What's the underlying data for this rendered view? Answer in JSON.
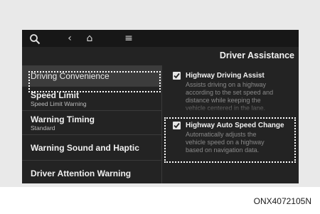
{
  "topbar": {
    "back_icon": "‹",
    "home_icon": "⌂",
    "menu_icon": "≡"
  },
  "header": {
    "title": "Driver Assistance"
  },
  "menu": {
    "items": [
      {
        "label": "Driving Convenience",
        "sub": ""
      },
      {
        "label": "Speed Limit",
        "sub": "Speed Limit Warning"
      },
      {
        "label": "Warning Timing",
        "sub": "Standard"
      },
      {
        "label": "Warning Sound and Haptic",
        "sub": ""
      },
      {
        "label": "Driver Attention Warning",
        "sub": ""
      }
    ]
  },
  "options": [
    {
      "title": "Highway Driving Assist",
      "checked": true,
      "description": "Assists driving on a highway\naccording to the set speed and\ndistance while keeping the\nvehicle centered in the lane."
    },
    {
      "title": "Highway Auto Speed Change",
      "checked": true,
      "description": "Automatically adjusts the\nvehicle speed on a highway\nbased on navigation data."
    }
  ],
  "caption": "ONX4072105N",
  "colors": {
    "screen_bg": "#232323",
    "topbar_bg": "#171717",
    "selected_bg": "#3c3c3c",
    "highlight": "#ffffff"
  }
}
